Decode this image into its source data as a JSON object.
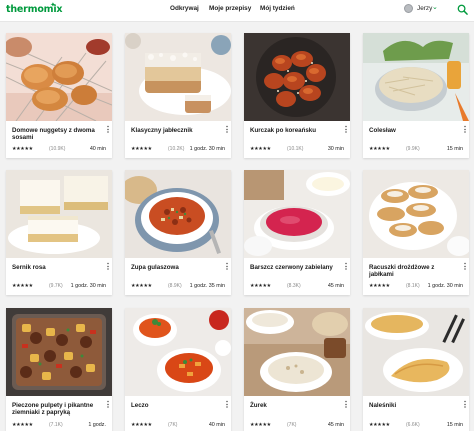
{
  "header": {
    "logo": "thermomix",
    "nav": [
      "Odkrywaj",
      "Moje przepisy",
      "Mój tydzień"
    ],
    "user": "Jerzy"
  },
  "colors": {
    "brand": "#009a3d",
    "background": "#f2f2f2"
  },
  "recipes": [
    {
      "title": "Domowe nuggetsy z dwoma sosami",
      "rating": 5,
      "count": "(10.9K)",
      "time": "40 min"
    },
    {
      "title": "Klasyczny jabłecznik",
      "rating": 5,
      "count": "(10.2K)",
      "time": "1 godz. 30 min"
    },
    {
      "title": "Kurczak po koreańsku",
      "rating": 5,
      "count": "(10.1K)",
      "time": "30 min"
    },
    {
      "title": "Colesław",
      "rating": 5,
      "count": "(9.9K)",
      "time": "15 min"
    },
    {
      "title": "Sernik rosa",
      "rating": 5,
      "count": "(9.7K)",
      "time": "1 godz. 30 min"
    },
    {
      "title": "Zupa gulaszowa",
      "rating": 5,
      "count": "(8.9K)",
      "time": "1 godz. 35 min"
    },
    {
      "title": "Barszcz czerwony zabielany",
      "rating": 5,
      "count": "(8.3K)",
      "time": "45 min"
    },
    {
      "title": "Racuszki drożdżowe z jabłkami",
      "rating": 5,
      "count": "(8.1K)",
      "time": "1 godz. 30 min"
    },
    {
      "title": "Pieczone pulpety i pikantne ziemniaki z papryką",
      "rating": 5,
      "count": "(7.1K)",
      "time": "1 godz."
    },
    {
      "title": "Leczo",
      "rating": 5,
      "count": "(7K)",
      "time": "40 min"
    },
    {
      "title": "Żurek",
      "rating": 5,
      "count": "(7K)",
      "time": "45 min"
    },
    {
      "title": "Naleśniki",
      "rating": 5,
      "count": "(6.6K)",
      "time": "15 min"
    }
  ]
}
